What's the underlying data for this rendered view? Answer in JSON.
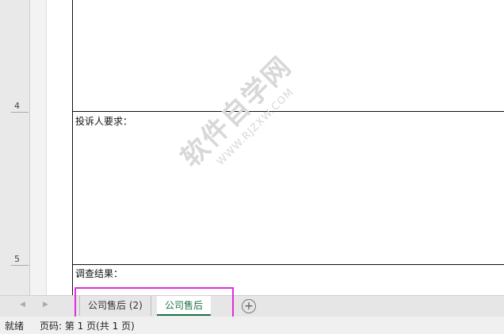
{
  "ruler": {
    "marks": [
      "4",
      "5"
    ]
  },
  "form": {
    "complaint_request_label": "投诉人要求：",
    "investigation_result_label": "调查结果："
  },
  "watermark": {
    "main": "软件自学网",
    "sub": "WWW.RJZXW.COM"
  },
  "sheet_tabs": {
    "tabs": [
      {
        "label": "公司售后 (2)",
        "active": false
      },
      {
        "label": "公司售后",
        "active": true
      }
    ],
    "add_icon": "plus-circle-icon",
    "nav_icons": [
      "scroll-left-icon",
      "scroll-right-icon"
    ],
    "highlight_color": "#e12ce1",
    "active_color": "#1e7145"
  },
  "status_bar": {
    "ready": "就绪",
    "page_info": "页码: 第 1 页(共 1 页)"
  }
}
